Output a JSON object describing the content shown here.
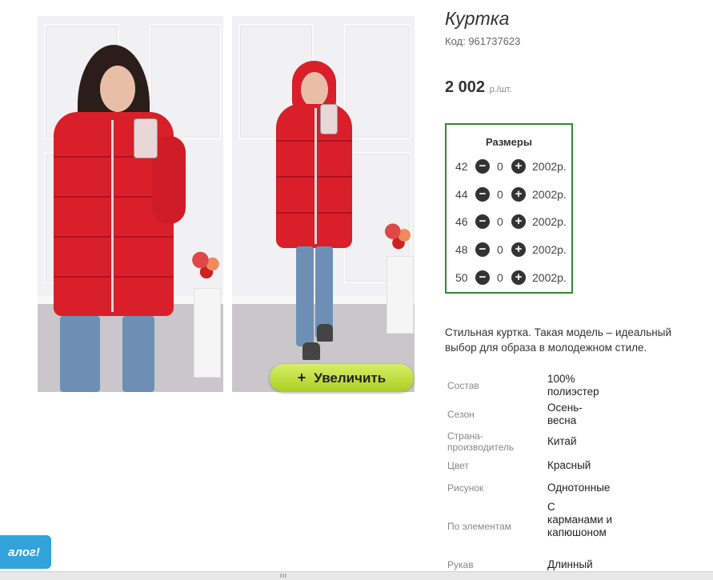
{
  "product": {
    "title": "Куртка",
    "code": "Код: 961737623",
    "price": "2 002",
    "price_unit": "р./шт.",
    "zoom_button": "Увеличить",
    "zoom_plus": "+",
    "description": "Стильная куртка. Такая модель – идеальный выбор для образа в молодежном стиле."
  },
  "sizes": {
    "title": "Размеры",
    "minus": "−",
    "plus": "+",
    "rows": [
      {
        "size": "42",
        "qty": "0",
        "price": "2002р."
      },
      {
        "size": "44",
        "qty": "0",
        "price": "2002р."
      },
      {
        "size": "46",
        "qty": "0",
        "price": "2002р."
      },
      {
        "size": "48",
        "qty": "0",
        "price": "2002р."
      },
      {
        "size": "50",
        "qty": "0",
        "price": "2002р."
      }
    ]
  },
  "properties": [
    {
      "label": "Состав",
      "value": "100% полиэстер"
    },
    {
      "label": "Сезон",
      "value": "Осень-весна"
    },
    {
      "label": "Страна-производитель",
      "value": "Китай"
    },
    {
      "label": "Цвет",
      "value": "Красный"
    },
    {
      "label": "Рисунок",
      "value": "Однотонные"
    },
    {
      "label": "По элементам",
      "value": "С карманами и капюшоном"
    },
    {
      "label": "Рукав",
      "value": "Длинный"
    }
  ],
  "catalog_tab": "алог!",
  "scroll_grip": "III",
  "colors": {
    "size_box_border": "#2e8b2e",
    "zoom_button": "#a9cf22",
    "catalog_tab": "#33a3dc",
    "jacket": "#d81f2a"
  }
}
